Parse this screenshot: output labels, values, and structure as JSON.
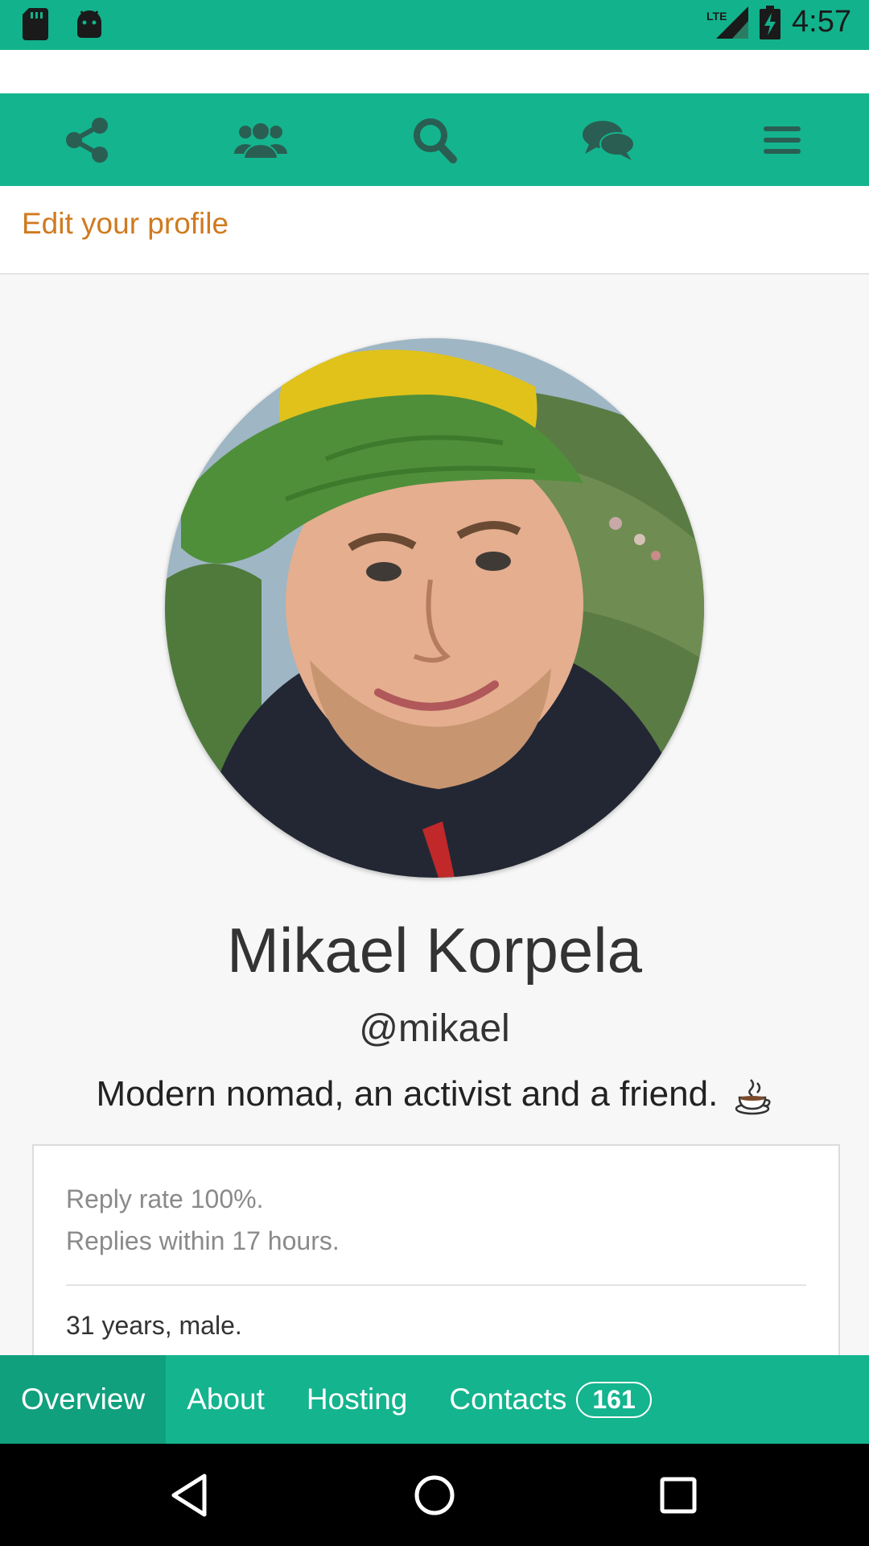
{
  "status_bar": {
    "time": "4:57",
    "network": "LTE",
    "icons": [
      "sd-card-icon",
      "android-icon",
      "signal-icon",
      "battery-charging-icon"
    ]
  },
  "navbar": {
    "icons": [
      "share-icon",
      "people-icon",
      "search-icon",
      "chat-icon",
      "menu-icon"
    ]
  },
  "edit_profile": {
    "label": "Edit your profile"
  },
  "profile": {
    "name": "Mikael Korpela",
    "username": "@mikael",
    "tagline": "Modern nomad, an activist and a friend."
  },
  "stats": {
    "reply_rate": "Reply rate 100%.",
    "reply_time": "Replies within 17 hours.",
    "age_gender": "31 years, male."
  },
  "tabs": [
    {
      "label": "Overview",
      "active": true
    },
    {
      "label": "About"
    },
    {
      "label": "Hosting"
    },
    {
      "label": "Contacts",
      "badge": "161"
    }
  ],
  "colors": {
    "brand": "#14b48e",
    "status_bar": "#12b28c",
    "edit_link": "#d07a1f",
    "active_tab": "#10a07e"
  },
  "system_nav": {
    "icons": [
      "back-icon",
      "home-icon",
      "recents-icon"
    ]
  }
}
